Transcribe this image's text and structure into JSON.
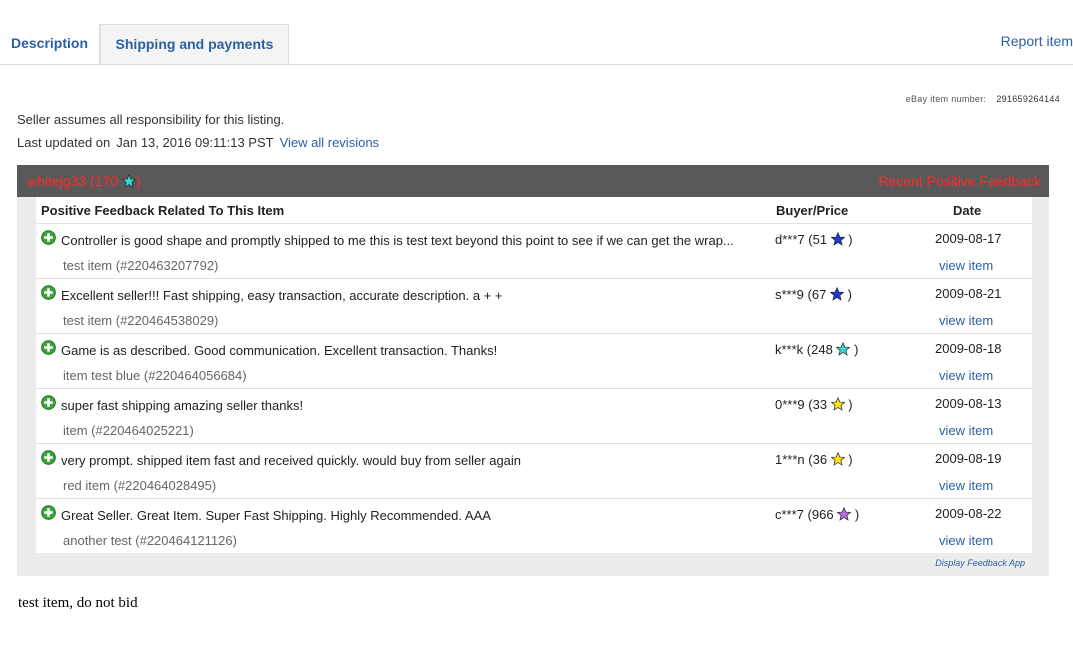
{
  "tabs": [
    {
      "label": "Description"
    },
    {
      "label": "Shipping and payments"
    }
  ],
  "report_link": "Report item",
  "item_number": {
    "label": "eBay item number:",
    "value": "291659264144"
  },
  "seller_note": "Seller assumes all responsibility for this listing.",
  "last_updated": {
    "label": "Last updated on",
    "date": "Jan 13, 2016 09:11:13 PST",
    "link": "View all revisions"
  },
  "feedback": {
    "seller": {
      "name": "whitejg33",
      "score": "170"
    },
    "title": "Recent Positive Feedback",
    "headers": {
      "comment": "Positive Feedback Related To This Item",
      "buyer": "Buyer/Price",
      "date": "Date"
    },
    "rows": [
      {
        "comment": "Controller is good shape and promptly shipped to me this is test text beyond this point to see if we can get the wrap...",
        "item": "test item (#220463207792)",
        "buyer": "d***7",
        "buyer_score": "51",
        "star": "blue-star-icon",
        "star_color": "#1a3bd6",
        "date": "2009-08-17",
        "view": "view item"
      },
      {
        "comment": "Excellent seller!!! Fast shipping, easy transaction, accurate description. a + +",
        "item": "test item (#220464538029)",
        "buyer": "s***9",
        "buyer_score": "67",
        "star": "blue-star-icon",
        "star_color": "#1a3bd6",
        "date": "2009-08-21",
        "view": "view item"
      },
      {
        "comment": "Game is as described. Good communication. Excellent transaction. Thanks!",
        "item": "item test blue (#220464056684)",
        "buyer": "k***k",
        "buyer_score": "248",
        "star": "turquoise-star-icon",
        "star_color": "#37d6d0",
        "date": "2009-08-18",
        "view": "view item"
      },
      {
        "comment": "super fast shipping amazing seller thanks!",
        "item": "item (#220464025221)",
        "buyer": "0***9",
        "buyer_score": "33",
        "star": "yellow-star-icon",
        "star_color": "#ffe11a",
        "date": "2009-08-13",
        "view": "view item"
      },
      {
        "comment": "very prompt. shipped item fast and received quickly. would buy from seller again",
        "item": "red item (#220464028495)",
        "buyer": "1***n",
        "buyer_score": "36",
        "star": "yellow-star-icon",
        "star_color": "#ffe11a",
        "date": "2009-08-19",
        "view": "view item"
      },
      {
        "comment": "Great Seller. Great Item. Super Fast Shipping. Highly Recommended. AAA",
        "item": "another test (#220464121126)",
        "buyer": "c***7",
        "buyer_score": "966",
        "star": "purple-star-icon",
        "star_color": "#b46fe0",
        "date": "2009-08-22",
        "view": "view item"
      }
    ],
    "app_link": "Display Feedback App"
  },
  "description_text": "test item, do not bid"
}
